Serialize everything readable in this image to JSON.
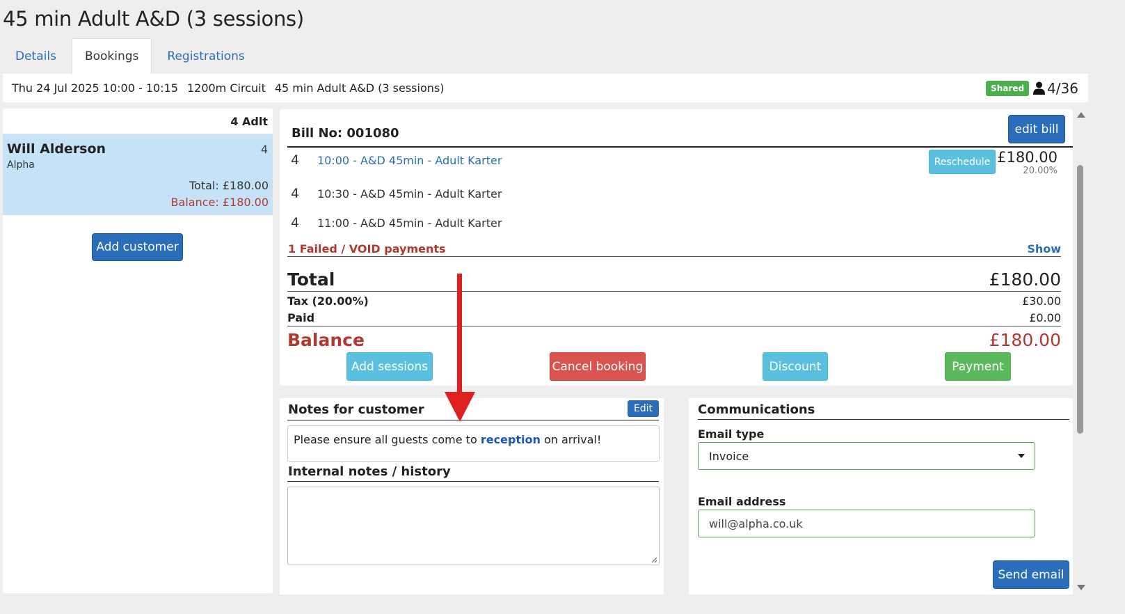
{
  "page": {
    "title": "45 min Adult A&D (3 sessions)"
  },
  "tabs": [
    {
      "label": "Details",
      "active": false
    },
    {
      "label": "Bookings",
      "active": true
    },
    {
      "label": "Registrations",
      "active": false
    }
  ],
  "infobar": {
    "datetime": "Thu 24 Jul 2025 10:00 - 10:15",
    "track": "1200m Circuit",
    "event": "45 min Adult A&D (3 sessions)",
    "badge": "Shared",
    "capacity": "4/36",
    "capacity_icon": "person-icon"
  },
  "customers": {
    "header": "4 Adlt",
    "items": [
      {
        "name": "Will Alderson",
        "count": "4",
        "company": "Alpha",
        "total": "Total: £180.00",
        "balance": "Balance: £180.00"
      }
    ],
    "add_label": "Add customer"
  },
  "bill": {
    "title": "Bill No: 001080",
    "edit_label": "edit bill",
    "lines": [
      {
        "qty": "4",
        "desc": "10:00 - A&D 45min - Adult Karter",
        "link": true
      },
      {
        "qty": "4",
        "desc": "10:30 - A&D 45min - Adult Karter",
        "link": false
      },
      {
        "qty": "4",
        "desc": "11:00 - A&D 45min - Adult Karter",
        "link": false
      }
    ],
    "reschedule_label": "Reschedule",
    "line_price": "£180.00",
    "line_tax": "20.00%",
    "failed_text": "1 Failed / VOID payments",
    "show_label": "Show",
    "total_label": "Total",
    "total_value": "£180.00",
    "tax_label": "Tax (20.00%)",
    "tax_value": "£30.00",
    "paid_label": "Paid",
    "paid_value": "£0.00",
    "balance_label": "Balance",
    "balance_value": "£180.00",
    "actions": {
      "add_sessions": "Add sessions",
      "cancel_booking": "Cancel booking",
      "discount": "Discount",
      "payment": "Payment"
    }
  },
  "notes": {
    "title": "Notes for customer",
    "edit_label": "Edit",
    "text_before": "Please ensure all guests come to ",
    "text_highlight": "reception",
    "text_after": " on arrival!",
    "internal_title": "Internal notes / history",
    "internal_value": ""
  },
  "comms": {
    "title": "Communications",
    "email_type_label": "Email type",
    "email_type_value": "Invoice",
    "email_address_label": "Email address",
    "email_address_value": "will@alpha.co.uk",
    "send_label": "Send email"
  },
  "colors": {
    "primary": "#2a6db8",
    "info": "#5bc0de",
    "danger": "#d9534f",
    "success": "#5cb85c",
    "balance_red": "#b03a30",
    "annotation_arrow": "#e02020"
  }
}
